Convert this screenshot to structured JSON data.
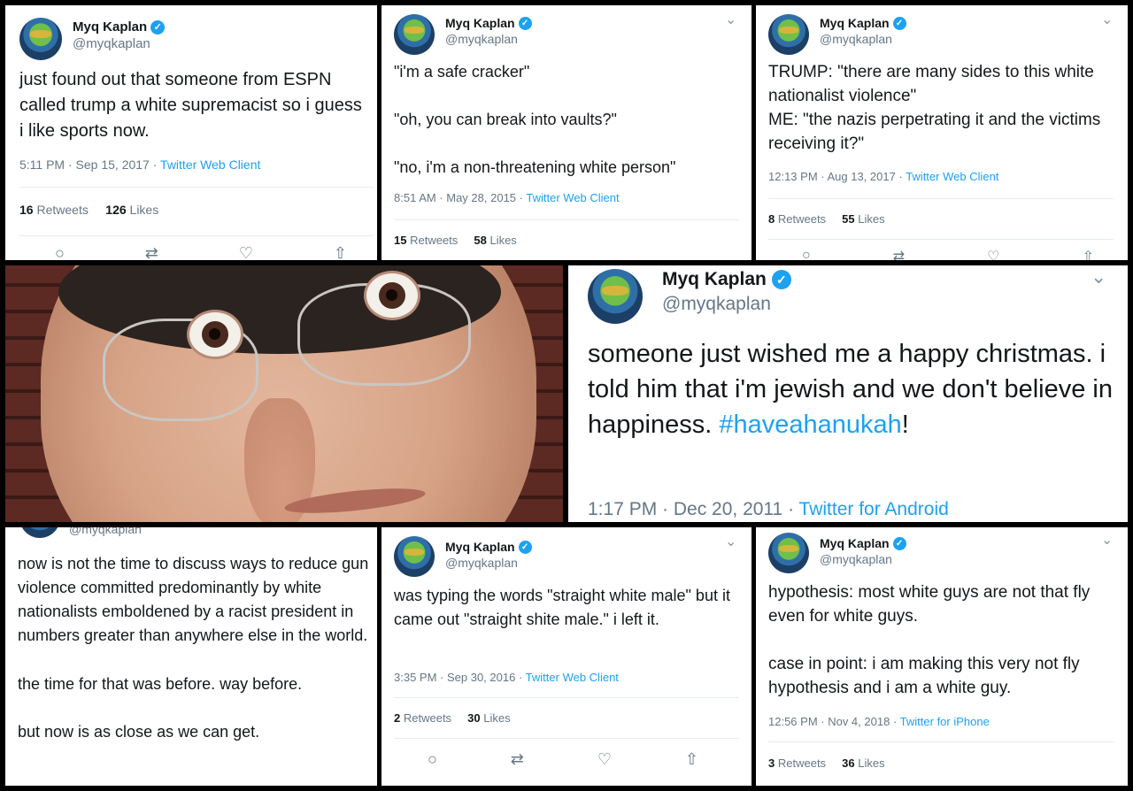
{
  "user": {
    "name": "Myq Kaplan",
    "handle": "@myqkaplan",
    "verified_glyph": "✓",
    "avatar_icon": "avatar-icon"
  },
  "labels": {
    "retweets": "Retweets",
    "likes": "Likes",
    "chevron": "⌄",
    "sep": "·"
  },
  "tweets": [
    {
      "id": "t1",
      "lines": [
        "just found out that someone from ESPN called trump a white supremacist so i guess i like sports now."
      ],
      "time": "5:11 PM · Sep 15, 2017",
      "source": "Twitter Web Client",
      "retweets": "16",
      "likes": "126"
    },
    {
      "id": "t2",
      "lines": [
        "\"i'm a safe cracker\"",
        "\"oh, you can break into vaults?\"",
        "\"no, i'm a non-threatening white person\""
      ],
      "time": "8:51 AM · May 28, 2015",
      "source": "Twitter Web Client",
      "retweets": "15",
      "likes": "58"
    },
    {
      "id": "t3",
      "lines": [
        "TRUMP: \"there are many sides to this white nationalist violence\"",
        "ME: \"the nazis perpetrating it and the victims receiving it?\""
      ],
      "time": "12:13 PM · Aug 13, 2017",
      "source": "Twitter Web Client",
      "retweets": "8",
      "likes": "55"
    },
    {
      "id": "t4",
      "text": "someone just wished me a happy christmas. i told him that i'm jewish and we don't believe in happiness.",
      "hashtag": "#haveahanukah",
      "after": "!",
      "time": "1:17 PM · Dec 20, 2011",
      "source": "Twitter for Android"
    },
    {
      "id": "t5",
      "handle_partial": "@myqkaplan",
      "lines": [
        "now is not the time to discuss ways to reduce gun violence committed predominantly by white nationalists emboldened by a racist president in numbers greater than anywhere else in the world.",
        "the time for that was before. way before.",
        "but now is as close as we can get."
      ]
    },
    {
      "id": "t6",
      "lines": [
        "was typing the words \"straight white male\" but it came out \"straight shite male.\" i left it."
      ],
      "time": "3:35 PM · Sep 30, 2016",
      "source": "Twitter Web Client",
      "retweets": "2",
      "likes": "30"
    },
    {
      "id": "t7",
      "lines": [
        "hypothesis: most white guys are not that fly even for white guys.",
        "case in point: i am making this very not fly hypothesis and i am a white guy."
      ],
      "time": "12:56 PM · Nov 4, 2018",
      "source": "Twitter for iPhone",
      "retweets": "3",
      "likes": "36"
    }
  ],
  "icons": {
    "reply": "reply-icon",
    "retweet": "retweet-icon",
    "like": "like-icon",
    "share": "share-icon",
    "verified": "verified-badge-icon"
  },
  "colors": {
    "link": "#1da1f2",
    "muted": "#657786",
    "text": "#14171a",
    "divider": "#e6ecf0",
    "background": "#000000"
  }
}
